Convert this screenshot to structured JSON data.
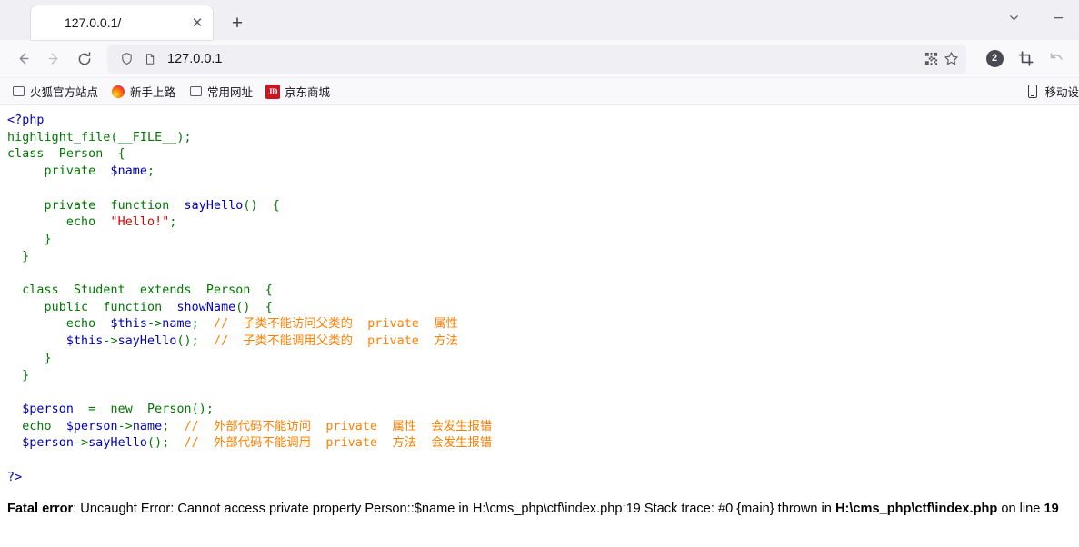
{
  "window": {
    "tablist_icon": "chevron-down-icon",
    "minimize_label": "—"
  },
  "tab": {
    "favicon": "firefox-icon",
    "title": "127.0.0.1/",
    "close_label": "✕",
    "new_tab_label": "+"
  },
  "toolbar": {
    "back_icon": "arrow-left-icon",
    "forward_icon": "arrow-right-icon",
    "reload_icon": "reload-icon",
    "shield_icon": "shield-icon",
    "page_icon": "page-icon",
    "url": "127.0.0.1",
    "qr_icon": "qr-code-icon",
    "bookmark_icon": "star-icon",
    "badge_count": "2",
    "crop_icon": "crop-icon",
    "undo_icon": "undo-arrow-icon"
  },
  "bookmarks": {
    "items": [
      {
        "label": "火狐官方站点",
        "icon": "folder-icon"
      },
      {
        "label": "新手上路",
        "icon": "firefox-icon"
      },
      {
        "label": "常用网址",
        "icon": "folder-icon"
      },
      {
        "label": "京东商城",
        "icon": "jd-logo-icon"
      }
    ],
    "right_item": {
      "label": "移动设",
      "icon": "mobile-device-icon"
    }
  },
  "code": {
    "lines": [
      [
        {
          "t": "<?php",
          "c": "c-blue"
        }
      ],
      [
        {
          "t": "highlight_file",
          "c": "c-green"
        },
        {
          "t": "(",
          "c": "c-green"
        },
        {
          "t": "__FILE__",
          "c": "c-green"
        },
        {
          "t": ");",
          "c": "c-green"
        }
      ],
      [
        {
          "t": "class  Person  {",
          "c": "c-green"
        }
      ],
      [
        {
          "t": "     private  ",
          "c": "c-green"
        },
        {
          "t": "$name",
          "c": "c-blue"
        },
        {
          "t": ";",
          "c": "c-green"
        }
      ],
      [
        {
          "t": "",
          "c": ""
        }
      ],
      [
        {
          "t": "     private  function  ",
          "c": "c-green"
        },
        {
          "t": "sayHello",
          "c": "c-blue"
        },
        {
          "t": "()  {",
          "c": "c-green"
        }
      ],
      [
        {
          "t": "        echo  ",
          "c": "c-green"
        },
        {
          "t": "\"Hello!\"",
          "c": "c-red"
        },
        {
          "t": ";",
          "c": "c-green"
        }
      ],
      [
        {
          "t": "     }",
          "c": "c-green"
        }
      ],
      [
        {
          "t": "  }",
          "c": "c-green"
        }
      ],
      [
        {
          "t": "",
          "c": ""
        }
      ],
      [
        {
          "t": "  class  Student  extends  Person  {",
          "c": "c-green"
        }
      ],
      [
        {
          "t": "     public  function  ",
          "c": "c-green"
        },
        {
          "t": "showName",
          "c": "c-blue"
        },
        {
          "t": "()  {",
          "c": "c-green"
        }
      ],
      [
        {
          "t": "        echo  ",
          "c": "c-green"
        },
        {
          "t": "$this",
          "c": "c-blue"
        },
        {
          "t": "->",
          "c": "c-green"
        },
        {
          "t": "name",
          "c": "c-blue"
        },
        {
          "t": ";  ",
          "c": "c-green"
        },
        {
          "t": "//  子类不能访问父类的  private  属性",
          "c": "c-orange"
        }
      ],
      [
        {
          "t": "        ",
          "c": "c-green"
        },
        {
          "t": "$this",
          "c": "c-blue"
        },
        {
          "t": "->",
          "c": "c-green"
        },
        {
          "t": "sayHello",
          "c": "c-blue"
        },
        {
          "t": "();  ",
          "c": "c-green"
        },
        {
          "t": "//  子类不能调用父类的  private  方法",
          "c": "c-orange"
        }
      ],
      [
        {
          "t": "     }",
          "c": "c-green"
        }
      ],
      [
        {
          "t": "  }",
          "c": "c-green"
        }
      ],
      [
        {
          "t": "",
          "c": ""
        }
      ],
      [
        {
          "t": "  ",
          "c": ""
        },
        {
          "t": "$person",
          "c": "c-blue"
        },
        {
          "t": "  =  new  ",
          "c": "c-green"
        },
        {
          "t": "Person",
          "c": "c-green"
        },
        {
          "t": "();",
          "c": "c-green"
        }
      ],
      [
        {
          "t": "  echo  ",
          "c": "c-green"
        },
        {
          "t": "$person",
          "c": "c-blue"
        },
        {
          "t": "->",
          "c": "c-green"
        },
        {
          "t": "name",
          "c": "c-blue"
        },
        {
          "t": ";  ",
          "c": "c-green"
        },
        {
          "t": "//  外部代码不能访问  private  属性  会发生报错",
          "c": "c-orange"
        }
      ],
      [
        {
          "t": "  ",
          "c": ""
        },
        {
          "t": "$person",
          "c": "c-blue"
        },
        {
          "t": "->",
          "c": "c-green"
        },
        {
          "t": "sayHello",
          "c": "c-blue"
        },
        {
          "t": "();  ",
          "c": "c-green"
        },
        {
          "t": "//  外部代码不能调用  private  方法  会发生报错",
          "c": "c-orange"
        }
      ],
      [
        {
          "t": "",
          "c": ""
        }
      ],
      [
        {
          "t": "?>",
          "c": "c-blue"
        }
      ]
    ],
    "colors": {
      "tag": "#0000BB",
      "keyword": "#007700",
      "string": "#DD0000",
      "comment": "#FF8000",
      "default": "#000000"
    }
  },
  "error": {
    "segments": [
      {
        "t": "Fatal error",
        "bold": true
      },
      {
        "t": ": Uncaught Error: Cannot access private property Person::$name in H:\\cms_php\\ctf\\index.php:19 Stack trace: #0 {main} thrown in ",
        "bold": false
      },
      {
        "t": "H:\\cms_php\\ctf\\index.php",
        "bold": true
      },
      {
        "t": " on line ",
        "bold": false
      },
      {
        "t": "19",
        "bold": true
      }
    ]
  }
}
